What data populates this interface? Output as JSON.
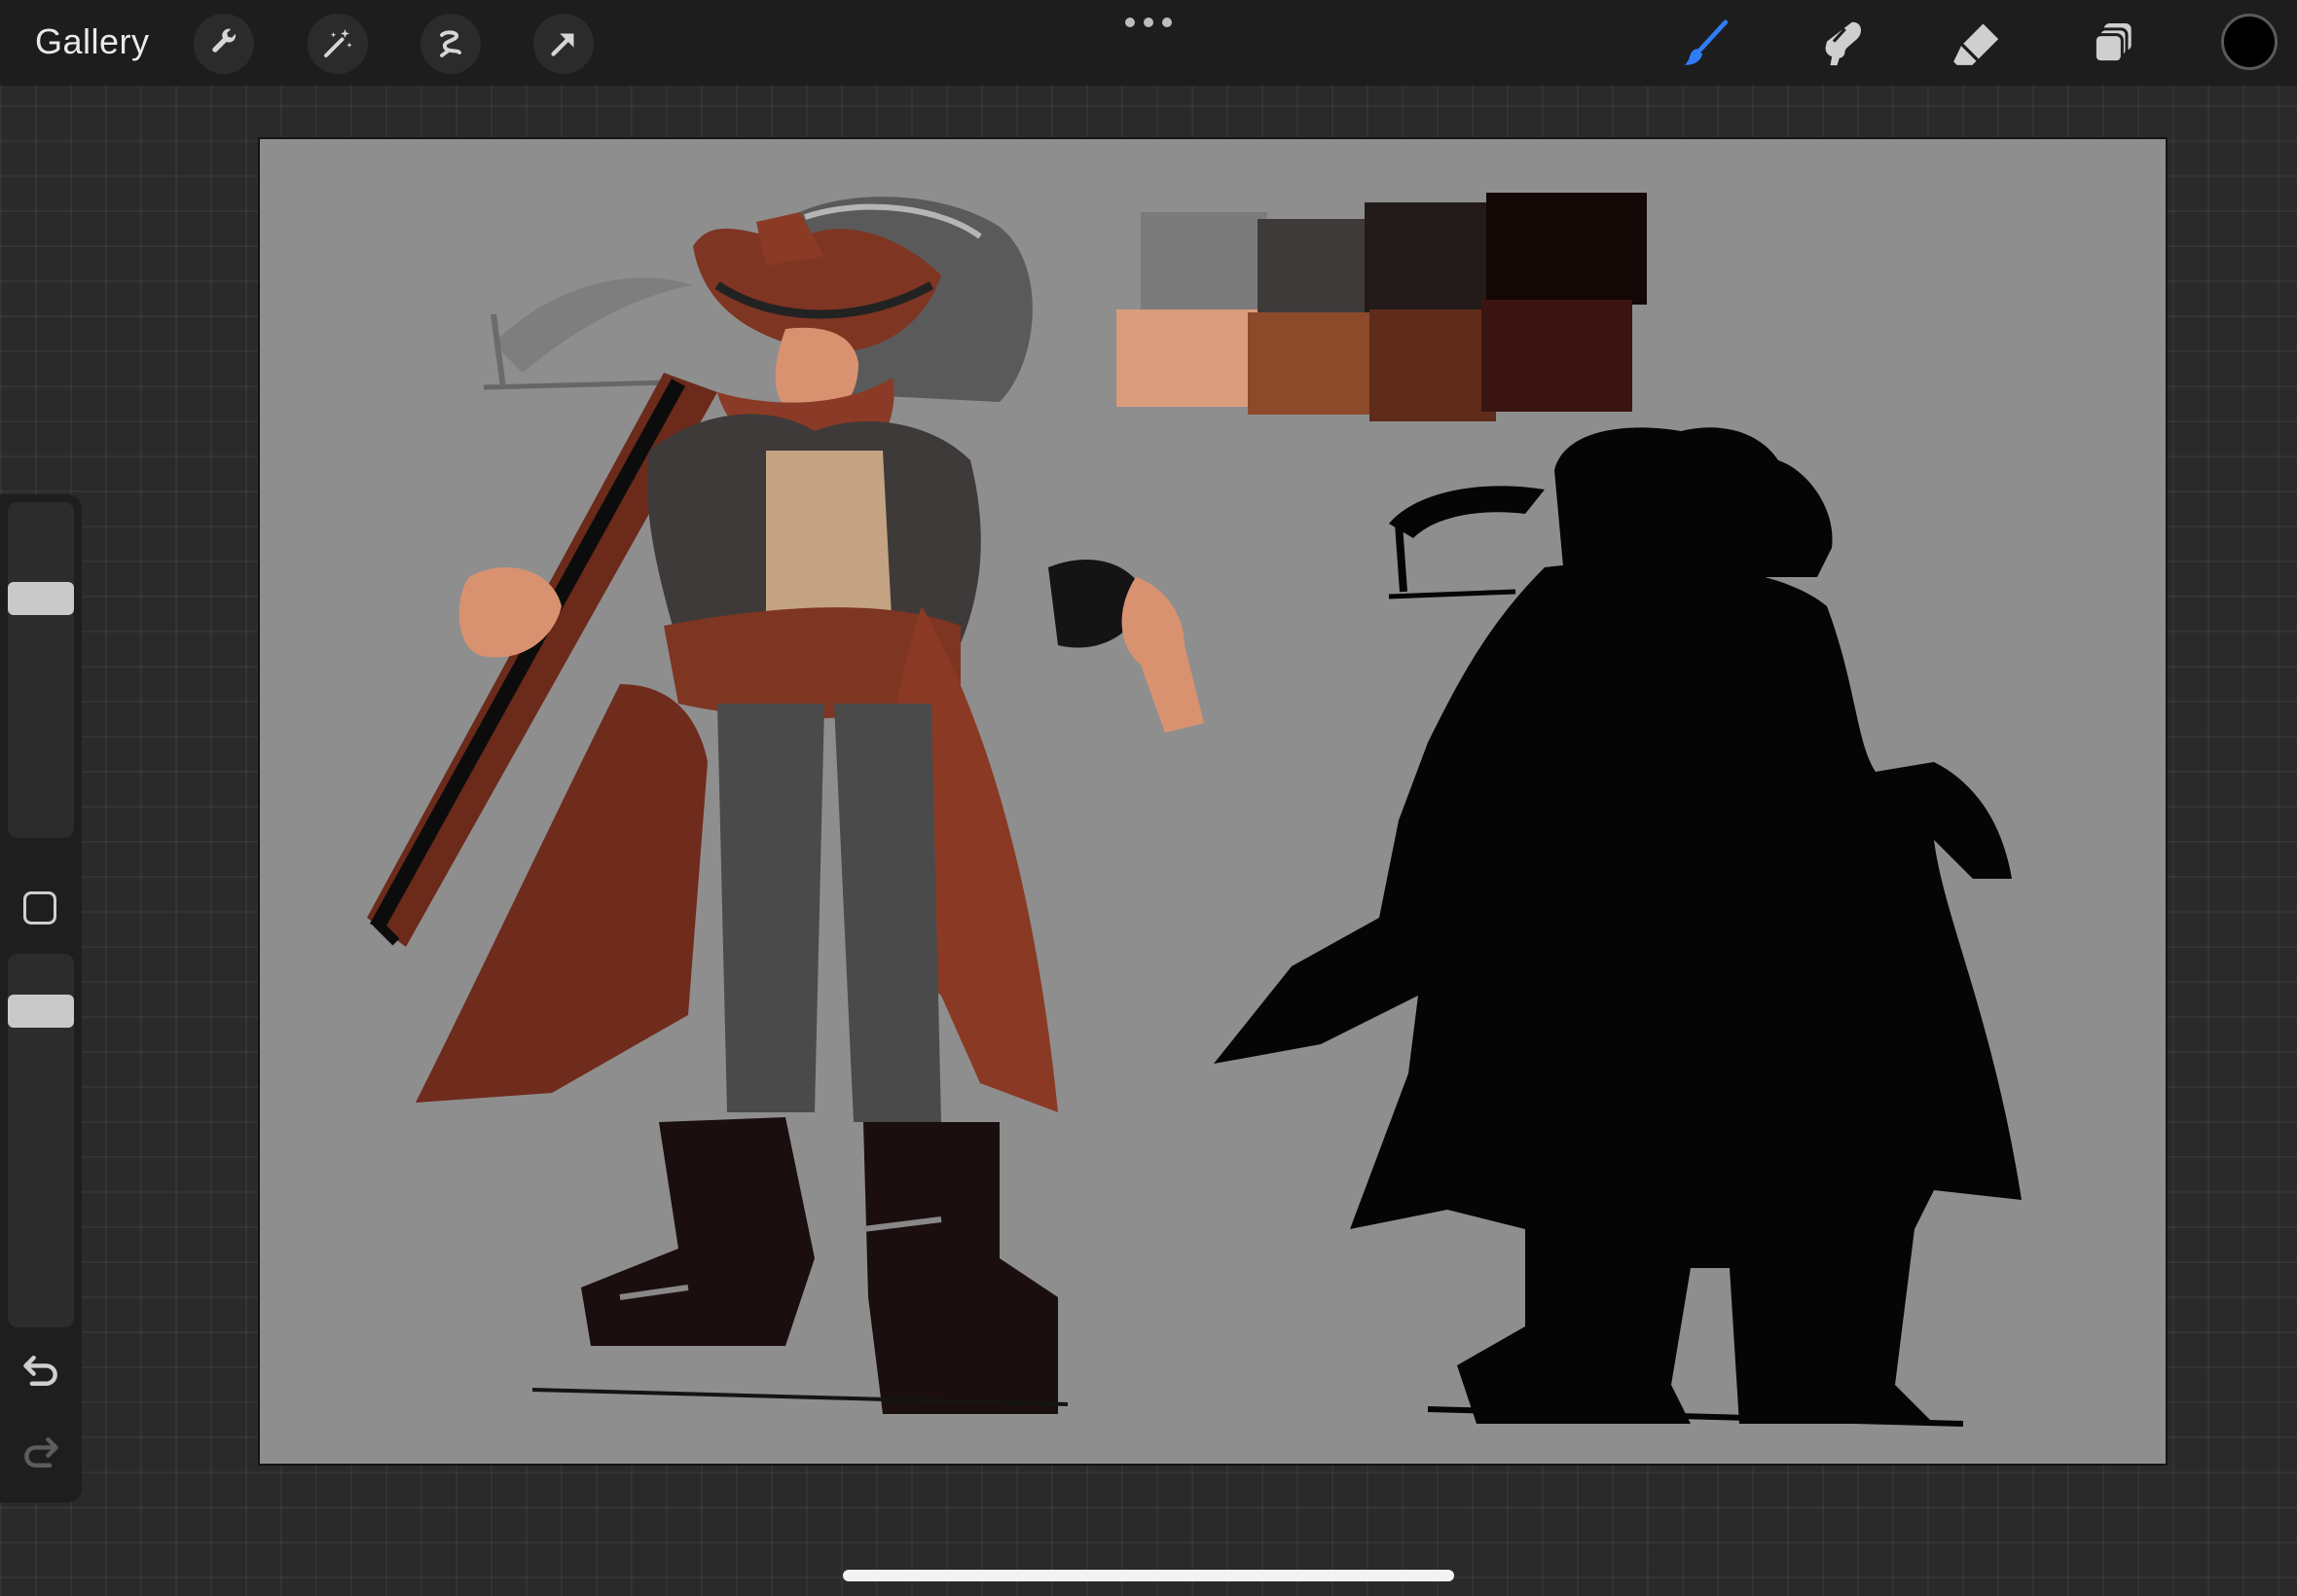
{
  "toolbar": {
    "gallery_label": "Gallery",
    "left_tools": [
      "wrench-icon",
      "magic-wand-icon",
      "selection-icon",
      "transform-arrow-icon"
    ],
    "right_tools": [
      "brush-icon",
      "smudge-icon",
      "eraser-icon",
      "layers-icon"
    ],
    "active_tool": "brush-icon",
    "accent_color": "#2f7cf6",
    "current_color": "#000000"
  },
  "sidebar": {
    "brush_size_level": 0.29,
    "opacity_level": 0.87,
    "icons": [
      "modify-square-icon",
      "undo-icon",
      "redo-icon"
    ]
  },
  "canvas": {
    "background_color": "#8e8e8e",
    "palette": {
      "top_row": [
        "#7b7b7b",
        "#3e3a39",
        "#221b1a",
        "#140807"
      ],
      "bottom_row": [
        "#d99c7d",
        "#8c4a2b",
        "#5f2b1b",
        "#3a1410"
      ]
    }
  }
}
